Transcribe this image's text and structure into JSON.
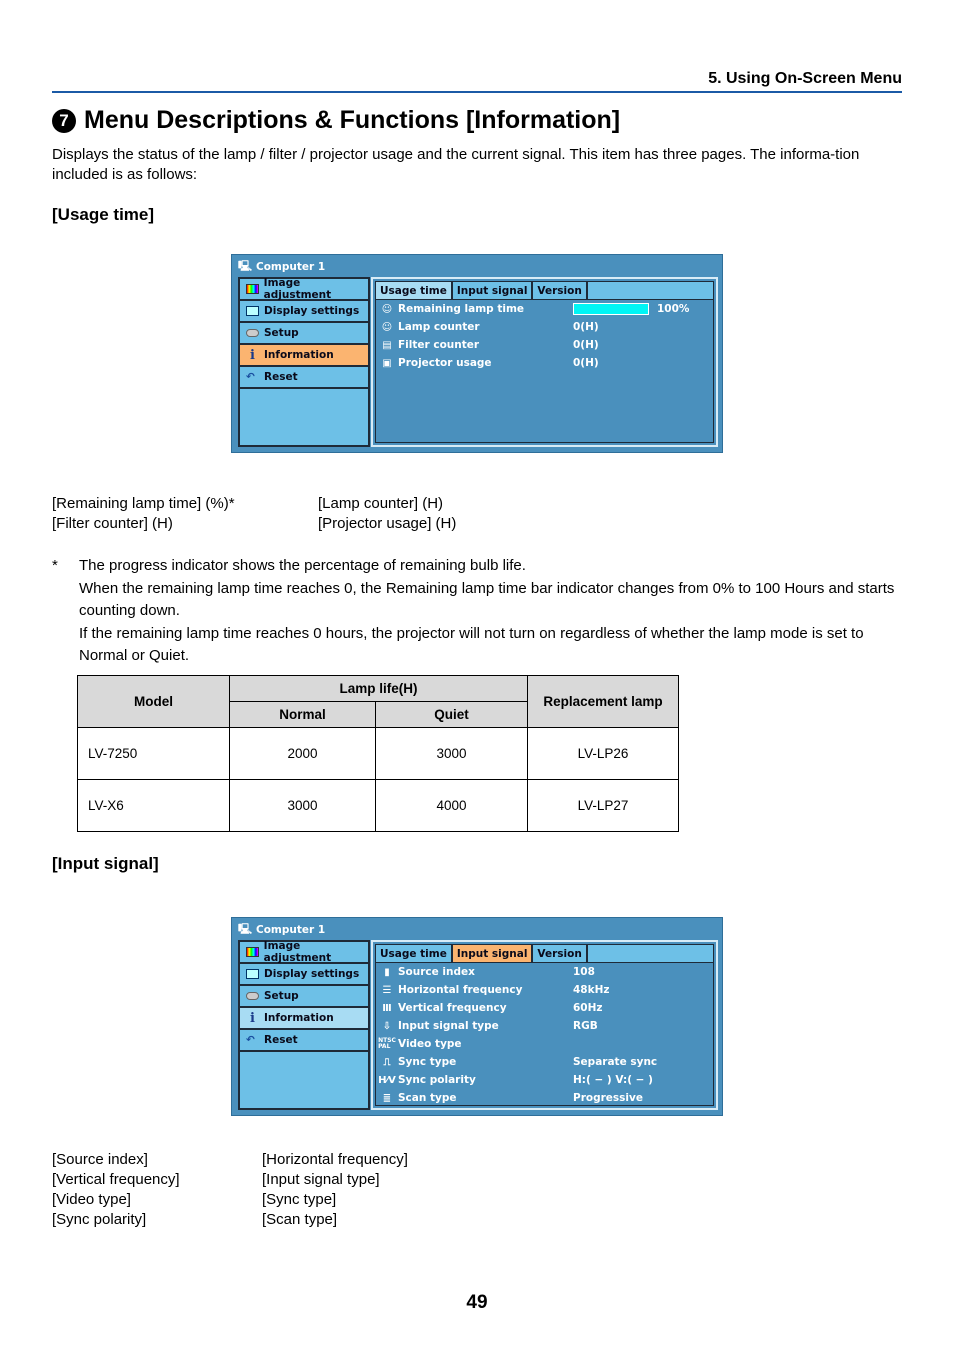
{
  "header": {
    "section": "5. Using On-Screen Menu"
  },
  "title": {
    "number": "7",
    "text": "Menu Descriptions & Functions [Information]"
  },
  "intro": "Displays the status of the lamp / filter / projector usage and the current signal. This item has three pages. The informa-tion included is as follows:",
  "usage_section": {
    "heading": "[Usage time]",
    "fields": [
      [
        "[Remaining lamp time] (%)*",
        "[Lamp counter] (H)"
      ],
      [
        "[Filter counter] (H)",
        "[Projector usage] (H)"
      ]
    ],
    "note_star": "*",
    "note_lines": [
      "The progress indicator shows the percentage of remaining bulb life.",
      "When the remaining lamp time reaches 0, the Remaining lamp time bar indicator changes from 0% to 100 Hours and starts counting down.",
      "If the remaining lamp time reaches 0 hours, the projector will not turn on regardless of whether the lamp mode is set to Normal or Quiet."
    ]
  },
  "osd_common": {
    "title": "Computer 1",
    "menu": [
      "Image adjustment",
      "Display settings",
      "Setup",
      "Information",
      "Reset"
    ],
    "tabs": [
      "Usage time",
      "Input signal",
      "Version"
    ]
  },
  "osd_usage": {
    "rows": [
      {
        "label": "Remaining lamp time",
        "value": "100%",
        "progress_percent": 100
      },
      {
        "label": "Lamp counter",
        "value": "0(H)"
      },
      {
        "label": "Filter counter",
        "value": "0(H)"
      },
      {
        "label": "Projector usage",
        "value": "0(H)"
      }
    ]
  },
  "lamp_table": {
    "headers": {
      "model": "Model",
      "lamp_life": "Lamp life(H)",
      "normal": "Normal",
      "quiet": "Quiet",
      "replacement": "Replacement lamp"
    },
    "rows": [
      {
        "model": "LV-7250",
        "normal": "2000",
        "quiet": "3000",
        "replacement": "LV-LP26"
      },
      {
        "model": "LV-X6",
        "normal": "3000",
        "quiet": "4000",
        "replacement": "LV-LP27"
      }
    ]
  },
  "input_section": {
    "heading": "[Input signal]",
    "fields": [
      [
        "[Source index]",
        "[Horizontal frequency]"
      ],
      [
        "[Vertical frequency]",
        "[Input signal type]"
      ],
      [
        "[Video type]",
        "[Sync type]"
      ],
      [
        "[Sync polarity]",
        "[Scan type]"
      ]
    ]
  },
  "osd_input": {
    "rows": [
      {
        "label": "Source index",
        "value": "108"
      },
      {
        "label": "Horizontal frequency",
        "value": "48kHz"
      },
      {
        "label": "Vertical frequency",
        "value": "60Hz"
      },
      {
        "label": "Input signal type",
        "value": "RGB"
      },
      {
        "label": "Video type",
        "value": ""
      },
      {
        "label": "Sync type",
        "value": "Separate sync"
      },
      {
        "label": "Sync polarity",
        "value": "H:( − ) V:( − )"
      },
      {
        "label": "Scan type",
        "value": "Progressive"
      }
    ]
  },
  "page_number": "49"
}
